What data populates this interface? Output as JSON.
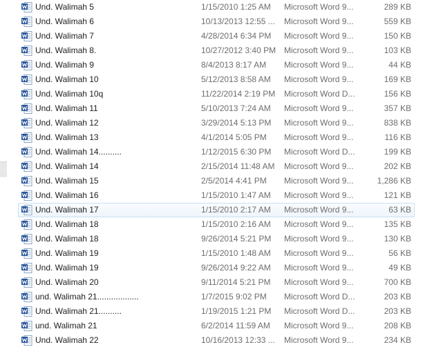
{
  "colors": {
    "name_text": "#1e1e1e",
    "meta_text": "#6d6d6d",
    "hover_border": "#c9dff4",
    "word_icon_blue": "#2a5699"
  },
  "icon": "word-document-icon",
  "files": [
    {
      "name": "Und. Walimah 5",
      "date": "1/15/2010 1:25 AM",
      "type": "Microsoft Word 9...",
      "size": "289 KB"
    },
    {
      "name": "Und. Walimah 6",
      "date": "10/13/2013 12:55 ...",
      "type": "Microsoft Word 9...",
      "size": "559 KB"
    },
    {
      "name": "Und. Walimah 7",
      "date": "4/28/2014 6:34 PM",
      "type": "Microsoft Word 9...",
      "size": "150 KB"
    },
    {
      "name": "Und. Walimah 8.",
      "date": "10/27/2012 3:40 PM",
      "type": "Microsoft Word 9...",
      "size": "103 KB"
    },
    {
      "name": "Und. Walimah 9",
      "date": "8/4/2013 8:17 AM",
      "type": "Microsoft Word 9...",
      "size": "44 KB"
    },
    {
      "name": "Und. Walimah 10",
      "date": "5/12/2013 8:58 AM",
      "type": "Microsoft Word 9...",
      "size": "169 KB"
    },
    {
      "name": "Und. Walimah 10q",
      "date": "11/22/2014 2:19 PM",
      "type": "Microsoft Word D...",
      "size": "156 KB"
    },
    {
      "name": "Und. Walimah 11",
      "date": "5/10/2013 7:24 AM",
      "type": "Microsoft Word 9...",
      "size": "357 KB"
    },
    {
      "name": "Und. Walimah 12",
      "date": "3/29/2014 5:13 PM",
      "type": "Microsoft Word 9...",
      "size": "838 KB"
    },
    {
      "name": "Und. Walimah 13",
      "date": "4/1/2014 5:05 PM",
      "type": "Microsoft Word 9...",
      "size": "116 KB"
    },
    {
      "name": "Und. Walimah 14..........",
      "date": "1/12/2015 6:30 PM",
      "type": "Microsoft Word D...",
      "size": "199 KB"
    },
    {
      "name": "Und. Walimah 14",
      "date": "2/15/2014 11:48 AM",
      "type": "Microsoft Word 9...",
      "size": "202 KB"
    },
    {
      "name": "Und. Walimah 15",
      "date": "2/5/2014 4:41 PM",
      "type": "Microsoft Word 9...",
      "size": "1,286 KB"
    },
    {
      "name": "Und. Walimah 16",
      "date": "1/15/2010 1:47 AM",
      "type": "Microsoft Word 9...",
      "size": "121 KB"
    },
    {
      "name": "Und. Walimah 17",
      "date": "1/15/2010 2:17 AM",
      "type": "Microsoft Word 9...",
      "size": "63 KB",
      "hover": true
    },
    {
      "name": "Und. Walimah 18",
      "date": "1/15/2010 2:16 AM",
      "type": "Microsoft Word 9...",
      "size": "135 KB"
    },
    {
      "name": "Und. Walimah 18",
      "date": "9/26/2014 5:21 PM",
      "type": "Microsoft Word 9...",
      "size": "130 KB"
    },
    {
      "name": "Und. Walimah 19",
      "date": "1/15/2010 1:48 AM",
      "type": "Microsoft Word 9...",
      "size": "56 KB"
    },
    {
      "name": "Und. Walimah 19",
      "date": "9/26/2014 9:22 AM",
      "type": "Microsoft Word 9...",
      "size": "49 KB"
    },
    {
      "name": "Und. Walimah 20",
      "date": "9/11/2014 5:21 PM",
      "type": "Microsoft Word 9...",
      "size": "700 KB"
    },
    {
      "name": "und. Walimah 21..................",
      "date": "1/7/2015 9:02 PM",
      "type": "Microsoft Word D...",
      "size": "203 KB"
    },
    {
      "name": "Und. Walimah 21..........",
      "date": "1/19/2015 1:21 PM",
      "type": "Microsoft Word D...",
      "size": "203 KB"
    },
    {
      "name": "und. Walimah 21",
      "date": "6/2/2014 11:59 AM",
      "type": "Microsoft Word 9...",
      "size": "208 KB"
    },
    {
      "name": "Und. Walimah 22",
      "date": "10/16/2013 12:33 ...",
      "type": "Microsoft Word 9...",
      "size": "234 KB"
    }
  ]
}
